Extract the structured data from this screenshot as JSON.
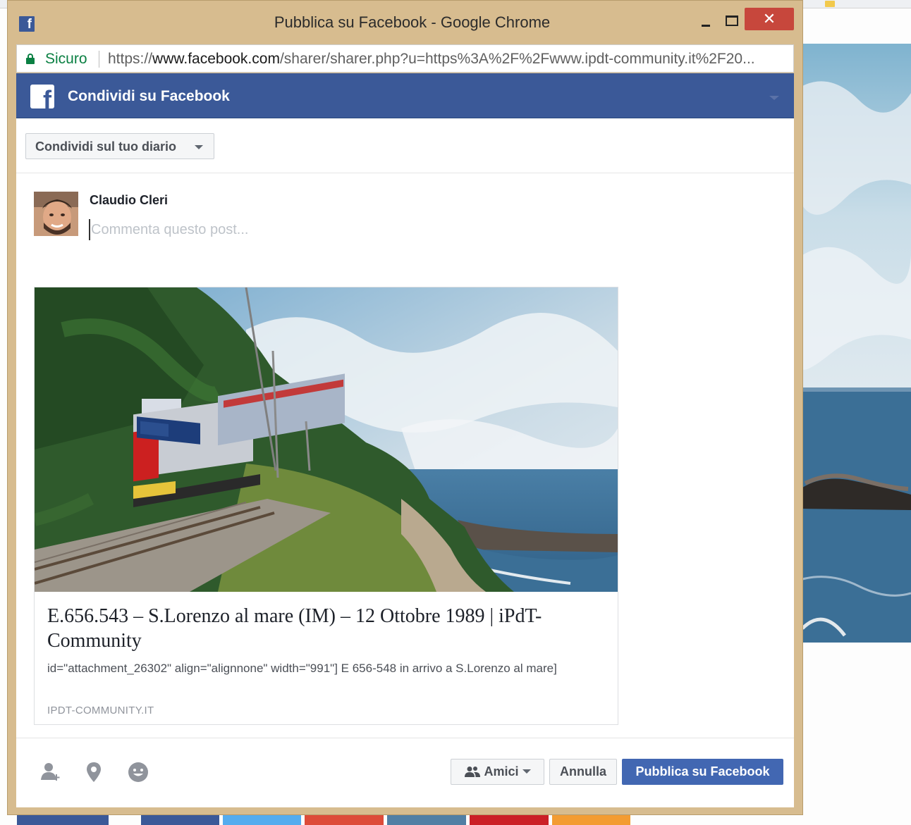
{
  "window": {
    "title": "Pubblica su Facebook - Google Chrome",
    "close_glyph": "✕"
  },
  "address_bar": {
    "secure_label": "Sicuro",
    "url_scheme": "https://",
    "url_host": "www.facebook.com",
    "url_path": "/sharer/sharer.php?u=https%3A%2F%2Fwww.ipdt-community.it%2F20..."
  },
  "dialog": {
    "header_title": "Condividi su Facebook",
    "share_target": "Condividi sul tuo diario",
    "user_name": "Claudio Cleri",
    "comment_placeholder": "Commenta questo post...",
    "preview": {
      "title": "E.656.543 – S.Lorenzo al mare (IM) – 12 Ottobre 1989 | iPdT-Community",
      "description": "id=\"attachment_26302\" align=\"alignnone\" width=\"991\"] E 656-548 in arrivo a S.Lorenzo al mare]",
      "domain": "IPDT-COMMUNITY.IT"
    },
    "tools": [
      "tag-people-icon",
      "location-pin-icon",
      "feeling-icon"
    ],
    "audience_label": "Amici",
    "cancel_label": "Annulla",
    "publish_label": "Pubblica su Facebook"
  },
  "colors": {
    "facebook_blue": "#3b5998",
    "publish_button": "#4267b2",
    "secure_green": "#0b8043",
    "window_frame": "#d7bc8f",
    "close_button": "#c7473c"
  }
}
